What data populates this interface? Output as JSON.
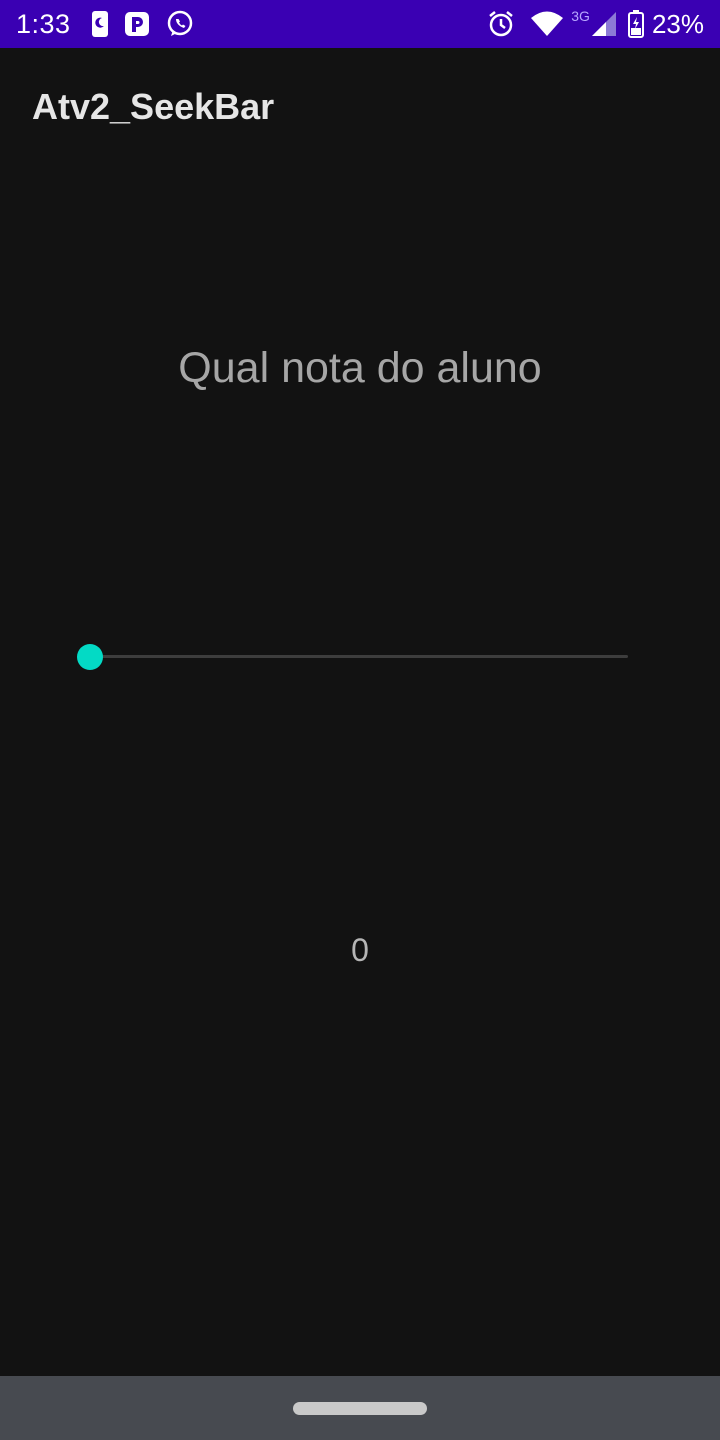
{
  "status_bar": {
    "time": "1:33",
    "left_icons": [
      "phone-moon-icon",
      "p-app-icon",
      "whatsapp-icon"
    ],
    "right_icons": [
      "alarm-icon",
      "wifi-icon",
      "cell-signal-icon",
      "battery-icon"
    ],
    "network_type": "3G",
    "battery_percent": "23%",
    "background_color": "#3a00b3"
  },
  "app_bar": {
    "title": "Atv2_SeekBar"
  },
  "main": {
    "question": "Qual nota do aluno",
    "seekbar": {
      "value": 0,
      "min": 0,
      "max": 10,
      "accent_color": "#03dac5"
    },
    "value_display": "0"
  },
  "nav_bar": {
    "type": "gesture-pill"
  }
}
